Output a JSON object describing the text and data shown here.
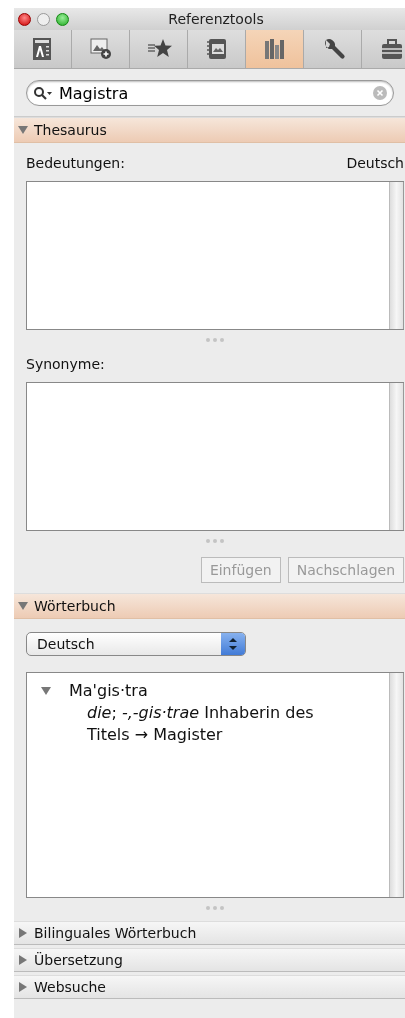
{
  "window": {
    "title": "Referenztools"
  },
  "toolbar": [
    {
      "selected": false
    },
    {
      "selected": false
    },
    {
      "selected": false
    },
    {
      "selected": false
    },
    {
      "selected": true
    },
    {
      "selected": false
    },
    {
      "selected": false
    }
  ],
  "search": {
    "value": "Magistra"
  },
  "sections": [
    {
      "kind": "thesaurus",
      "title": "Thesaurus",
      "expanded": true,
      "meanings_label": "Bedeutungen:",
      "language": "Deutsch",
      "synonyms_label": "Synonyme:",
      "buttons": [
        {
          "label": "Einfügen",
          "disabled": true
        },
        {
          "label": "Nachschlagen",
          "disabled": true
        }
      ]
    },
    {
      "kind": "dictionary",
      "title": "Wörterbuch",
      "expanded": true,
      "dictionary": "Deutsch",
      "entries": [
        {
          "headword": "Ma'gis·tra",
          "expanded": true,
          "definition": "*die*; *-,-gis·trae* Inhaberin des Titels → Magister"
        }
      ]
    },
    {
      "kind": "plain",
      "title": "Bilinguales Wörterbuch",
      "expanded": false
    },
    {
      "kind": "plain",
      "title": "Übersetzung",
      "expanded": false
    },
    {
      "kind": "plain",
      "title": "Websuche",
      "expanded": false
    }
  ]
}
